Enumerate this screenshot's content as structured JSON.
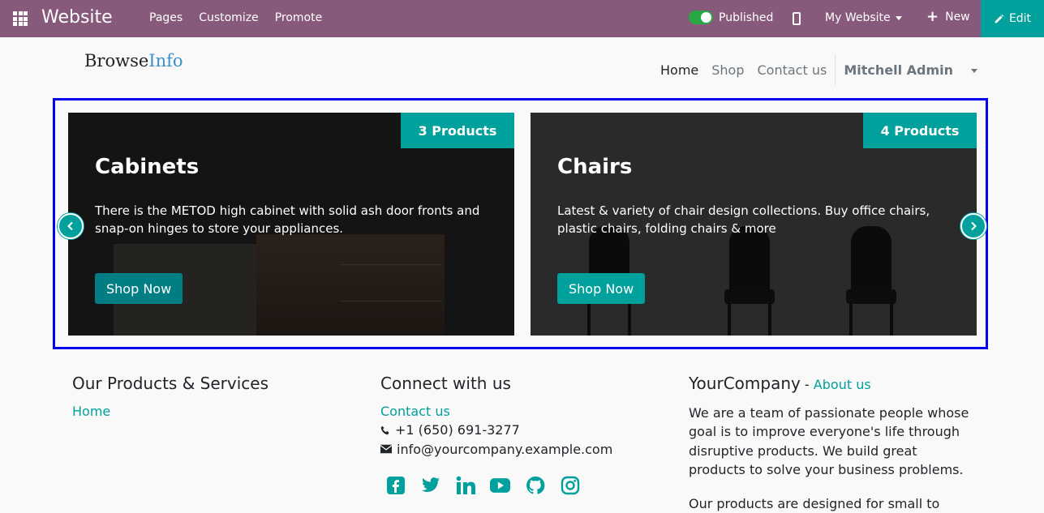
{
  "topbar": {
    "app_name": "Website",
    "menu": [
      "Pages",
      "Customize",
      "Promote"
    ],
    "published_label": "Published",
    "my_website": "My Website",
    "new_label": "New",
    "edit_label": "Edit"
  },
  "site": {
    "logo_part1": "Browse",
    "logo_part2": "Info",
    "nav": [
      "Home",
      "Shop",
      "Contact us"
    ],
    "user": "Mitchell Admin"
  },
  "carousel": {
    "cards": [
      {
        "badge": "3 Products",
        "title": "Cabinets",
        "description": "There is the METOD high cabinet with solid ash door fronts and snap-on hinges to store your appliances.",
        "button": "Shop Now"
      },
      {
        "badge": "4 Products",
        "title": "Chairs",
        "description": "Latest & variety of chair design collections. Buy office chairs, plastic chairs, folding chairs & more",
        "button": "Shop Now"
      }
    ]
  },
  "footer": {
    "col1": {
      "title": "Our Products & Services",
      "link": "Home"
    },
    "col2": {
      "title": "Connect with us",
      "link": "Contact us",
      "phone": "+1 (650) 691-3277",
      "email": "info@yourcompany.example.com"
    },
    "col3": {
      "company": "YourCompany",
      "separator": " - ",
      "about": "About us",
      "para1": "We are a team of passionate people whose goal is to improve everyone's life through disruptive products. We build great products to solve your business problems.",
      "para2": "Our products are designed for small to"
    }
  },
  "colors": {
    "topbar": "#875a7b",
    "accent": "#00a09d",
    "highlight_border": "#0000ee"
  }
}
